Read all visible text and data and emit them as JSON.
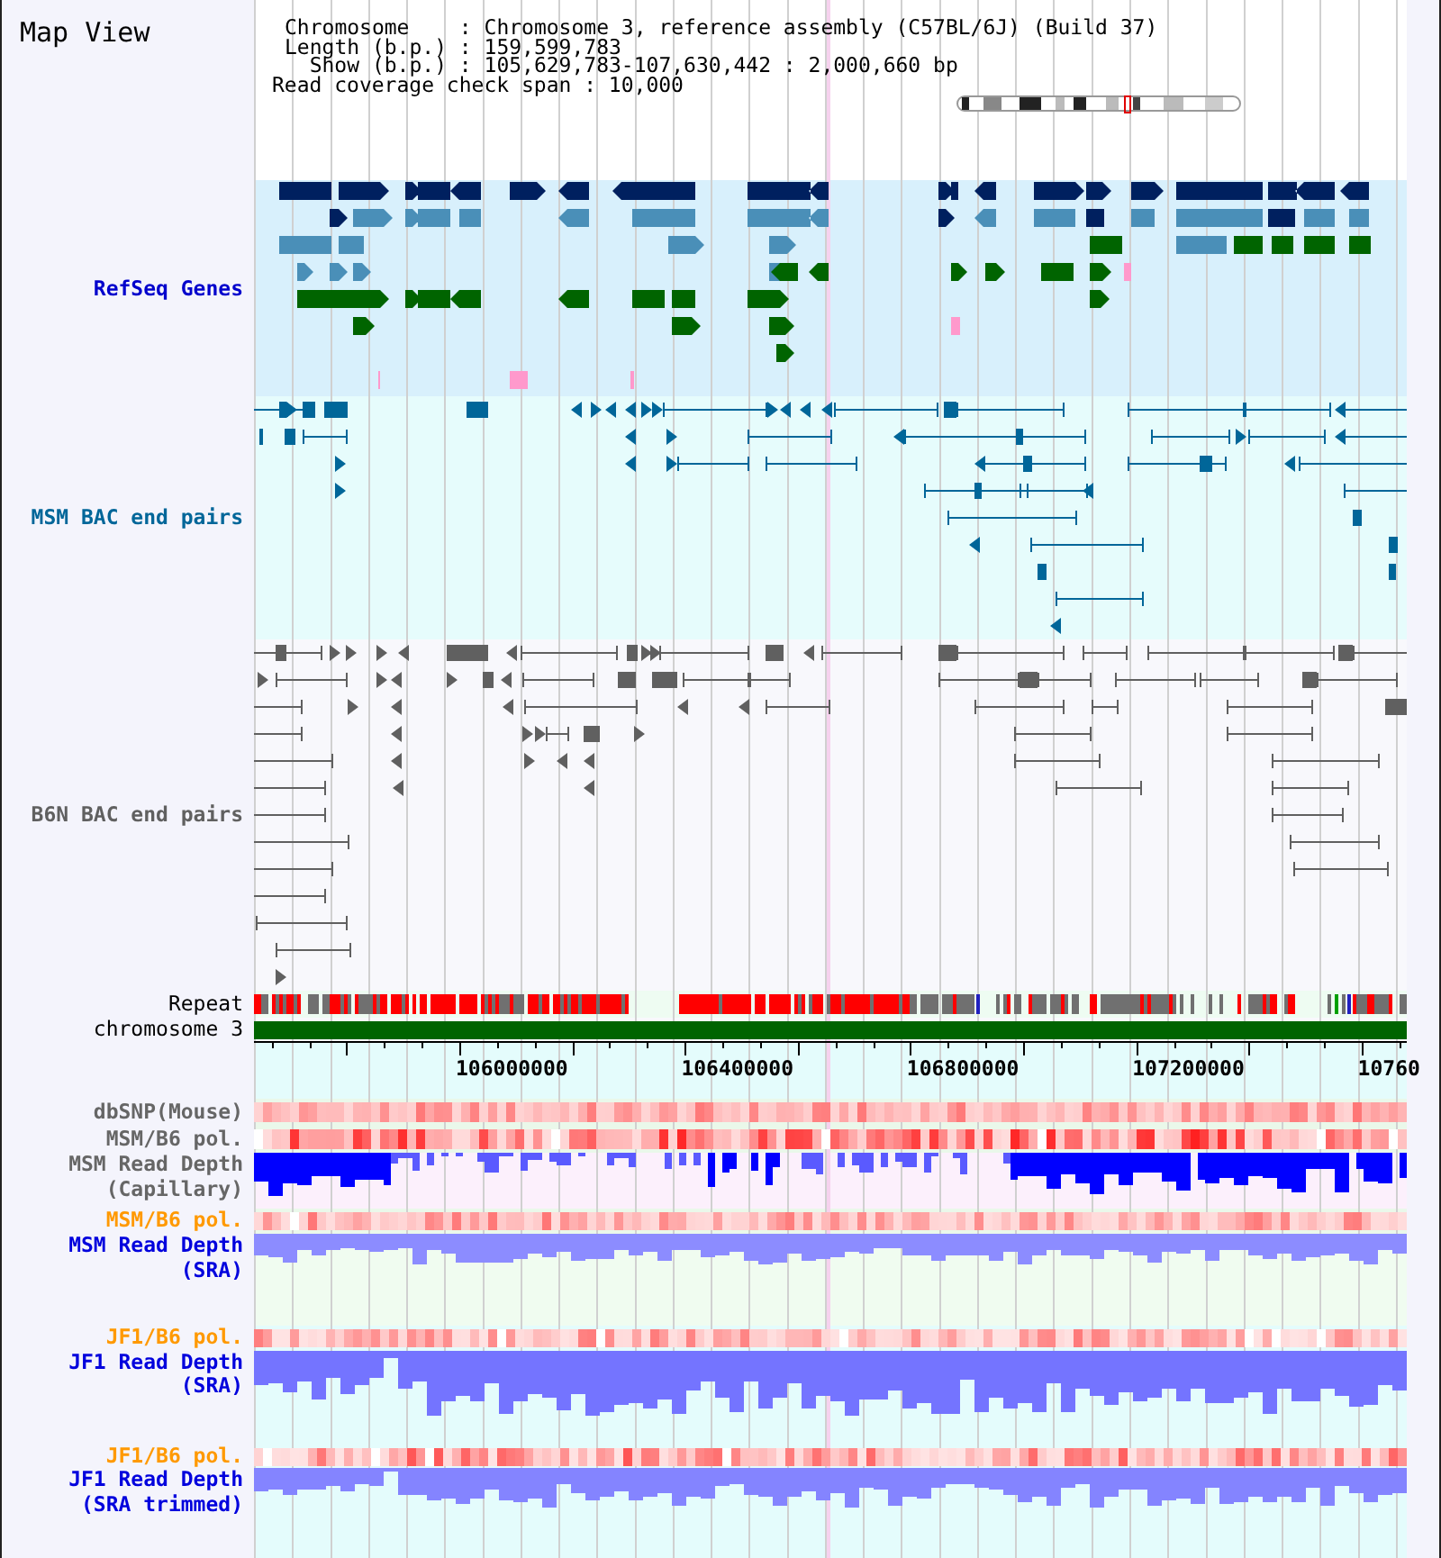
{
  "title": "Map View",
  "chromosome_info": [
    {
      "label": "Chromosome    :",
      "value": "Chromosome 3, reference assembly (C57BL/6J) (Build 37)"
    },
    {
      "label": "Length (b.p.) :",
      "value": "159,599,783"
    },
    {
      "label": "Show (b.p.) :",
      "value": "105,629,783-107,630,442 : 2,000,660 bp"
    }
  ],
  "coverage_span": "Read coverage check span : 10,000",
  "feature_tracks": [
    {
      "label": "RefSeq Genes",
      "kind": "genes",
      "color": "#0000cc"
    },
    {
      "label": "MSM BAC end pairs",
      "kind": "pairs",
      "color": "#006699"
    },
    {
      "label": "B6N BAC end pairs",
      "kind": "pairs",
      "color": "#606060"
    },
    {
      "label": "Repeat",
      "kind": "repeat",
      "color": "#000000"
    },
    {
      "label": "chromosome 3",
      "kind": "chromosome",
      "color": "#000000"
    }
  ],
  "axis_labels": [
    "106000000",
    "106400000",
    "106800000",
    "107200000",
    "10760"
  ],
  "data_tracks": [
    {
      "label": "dbSNP(Mouse)",
      "kind": "heatmap",
      "color": "#666666"
    },
    {
      "label": "MSM/B6 pol.",
      "kind": "heatmap",
      "color": "#666666"
    },
    {
      "label": "MSM Read Depth (Capillary)",
      "kind": "depth",
      "color": "#666666"
    },
    {
      "label": "MSM/B6 pol.",
      "kind": "heatmap",
      "color": "#ff9900"
    },
    {
      "label": "MSM Read Depth (SRA)",
      "kind": "depth",
      "color": "#0000dd"
    },
    {
      "label": "JF1/B6 pol.",
      "kind": "heatmap",
      "color": "#ff9900"
    },
    {
      "label": "JF1 Read Depth (SRA)",
      "kind": "depth",
      "color": "#0000dd"
    },
    {
      "label": "JF1/B6 pol.",
      "kind": "heatmap",
      "color": "#ff9900"
    },
    {
      "label": "JF1 Read Depth (SRA trimmed)",
      "kind": "depth",
      "color": "#0000dd"
    }
  ]
}
